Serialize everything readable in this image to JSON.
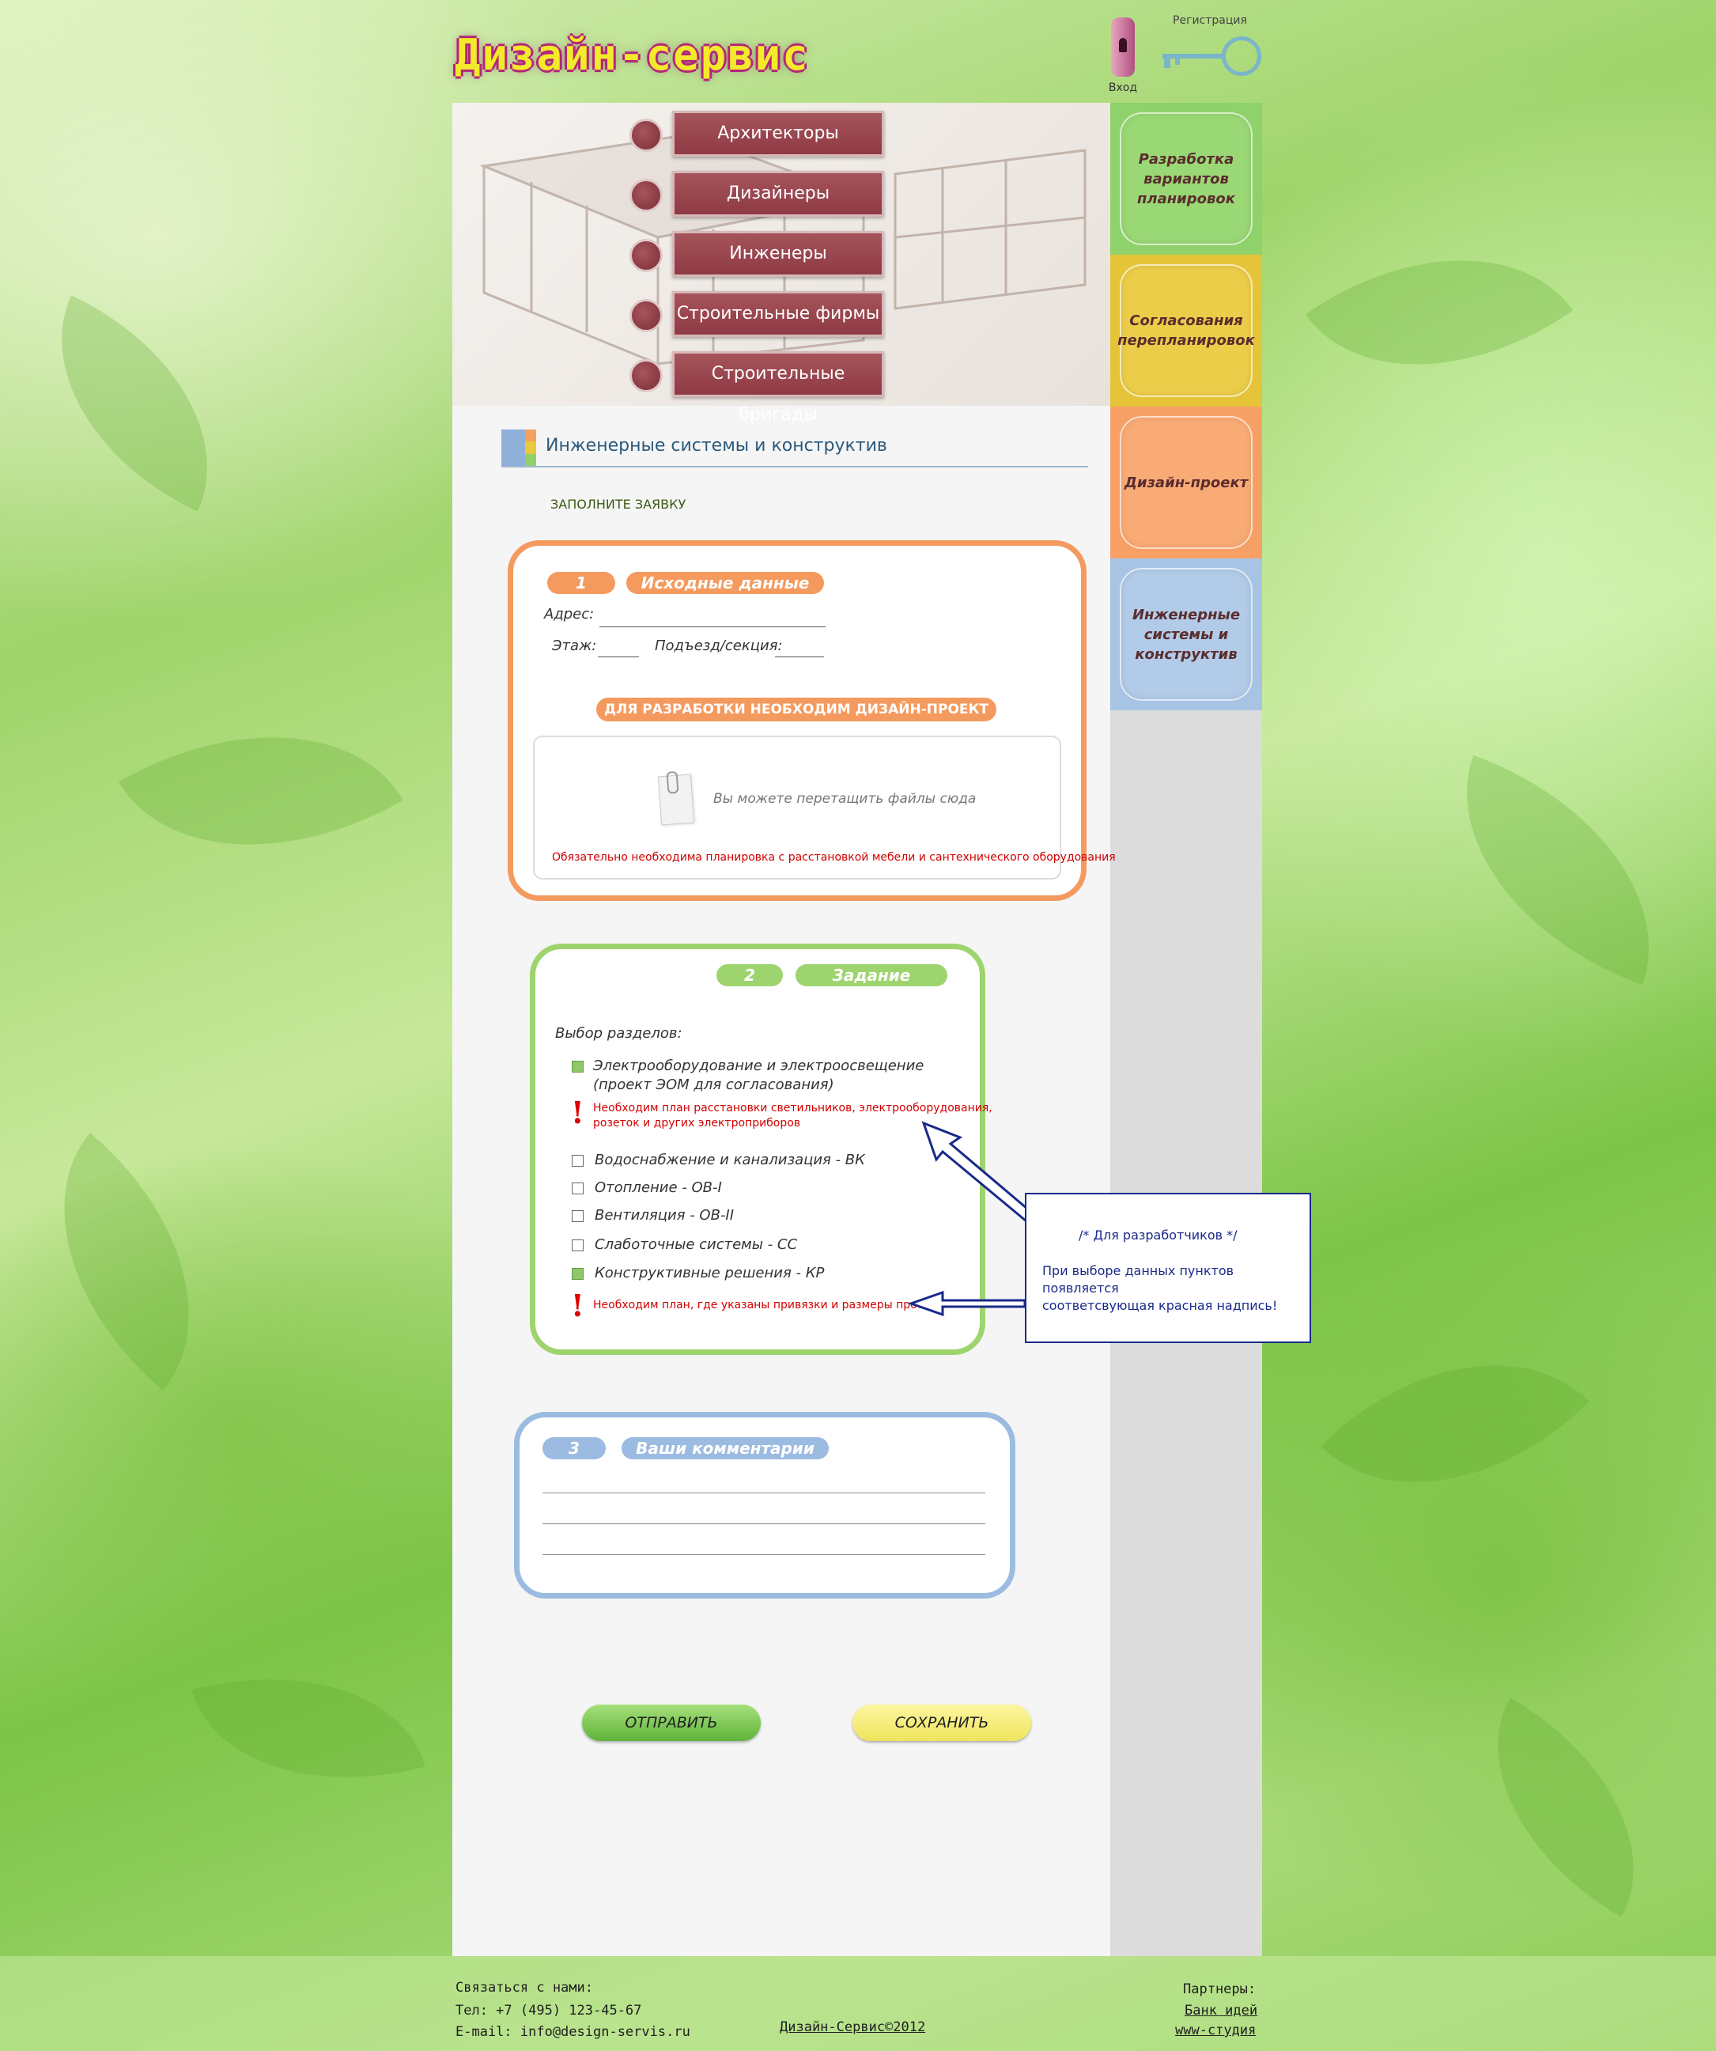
{
  "site": {
    "logo": "Дизайн-сервис"
  },
  "header": {
    "login_label": "Вход",
    "register_label": "Регистрация"
  },
  "nav": {
    "items": [
      "Архитекторы",
      "Дизайнеры",
      "Инженеры",
      "Строительные фирмы",
      "Строительные бригады"
    ]
  },
  "side_tabs": [
    {
      "label": "Разработка вариантов планировок",
      "color": "#8fd16a"
    },
    {
      "label": "Согласования перепланировок",
      "color": "#e6c43a"
    },
    {
      "label": "Дизайн-проект",
      "color": "#f7a066"
    },
    {
      "label": "Инженерные системы и конструктив",
      "color": "#a8c4e4"
    }
  ],
  "section": {
    "title": "Инженерные системы и конструктив",
    "fill_request": "ЗАПОЛНИТЕ ЗАЯВКУ"
  },
  "step1": {
    "number": "1",
    "title": "Исходные данные",
    "address_label": "Адрес:",
    "floor_label": "Этаж:",
    "entrance_label": "Подъезд/секция:",
    "banner": "ДЛЯ РАЗРАБОТКИ НЕОБХОДИМ ДИЗАЙН-ПРОЕКТ",
    "drop_text": "Вы можете перетащить файлы сюда",
    "warning": "Обязательно необходима планировка с расстановкой мебели и сантехнического оборудования",
    "color": "#f49a5e"
  },
  "step2": {
    "number": "2",
    "title": "Задание",
    "choose_label": "Выбор разделов:",
    "color": "#9ed46e",
    "items": [
      {
        "label": "Электрооборудование и электроосвещение",
        "label2": "(проект ЭОМ для согласования)",
        "checked": true,
        "hint": "Необходим план расстановки светильников, электрооборудования,",
        "hint2": "розеток и других электроприборов"
      },
      {
        "label": "Водоснабжение и канализация - ВК",
        "checked": false
      },
      {
        "label": "Отопление - ОВ-I",
        "checked": false
      },
      {
        "label": "Вентиляция - ОВ-II",
        "checked": false
      },
      {
        "label": "Слаботочные системы - СС",
        "checked": false
      },
      {
        "label": "Конструктивные решения - КР",
        "checked": true,
        "hint": "Необходим план, где указаны привязки и размеры проемов"
      }
    ]
  },
  "step3": {
    "number": "3",
    "title": "Ваши комментарии",
    "color": "#9cbbe0"
  },
  "actions": {
    "send": "ОТПРАВИТЬ",
    "save": "СОХРАНИТЬ"
  },
  "dev_note": {
    "heading": "/* Для разработчиков */",
    "line1": "При выборе данных пунктов появляется",
    "line2": "соответсвующая красная надпись!"
  },
  "footer": {
    "contact_heading": "Связаться с нами:",
    "phone": "Тел: +7 (495) 123-45-67",
    "email": "E-mail: info@design-servis.ru",
    "copyright": "Дизайн-Сервис©2012",
    "partners_heading": "Партнеры:",
    "partner1": "Банк идей",
    "partner2": "www-студия"
  }
}
